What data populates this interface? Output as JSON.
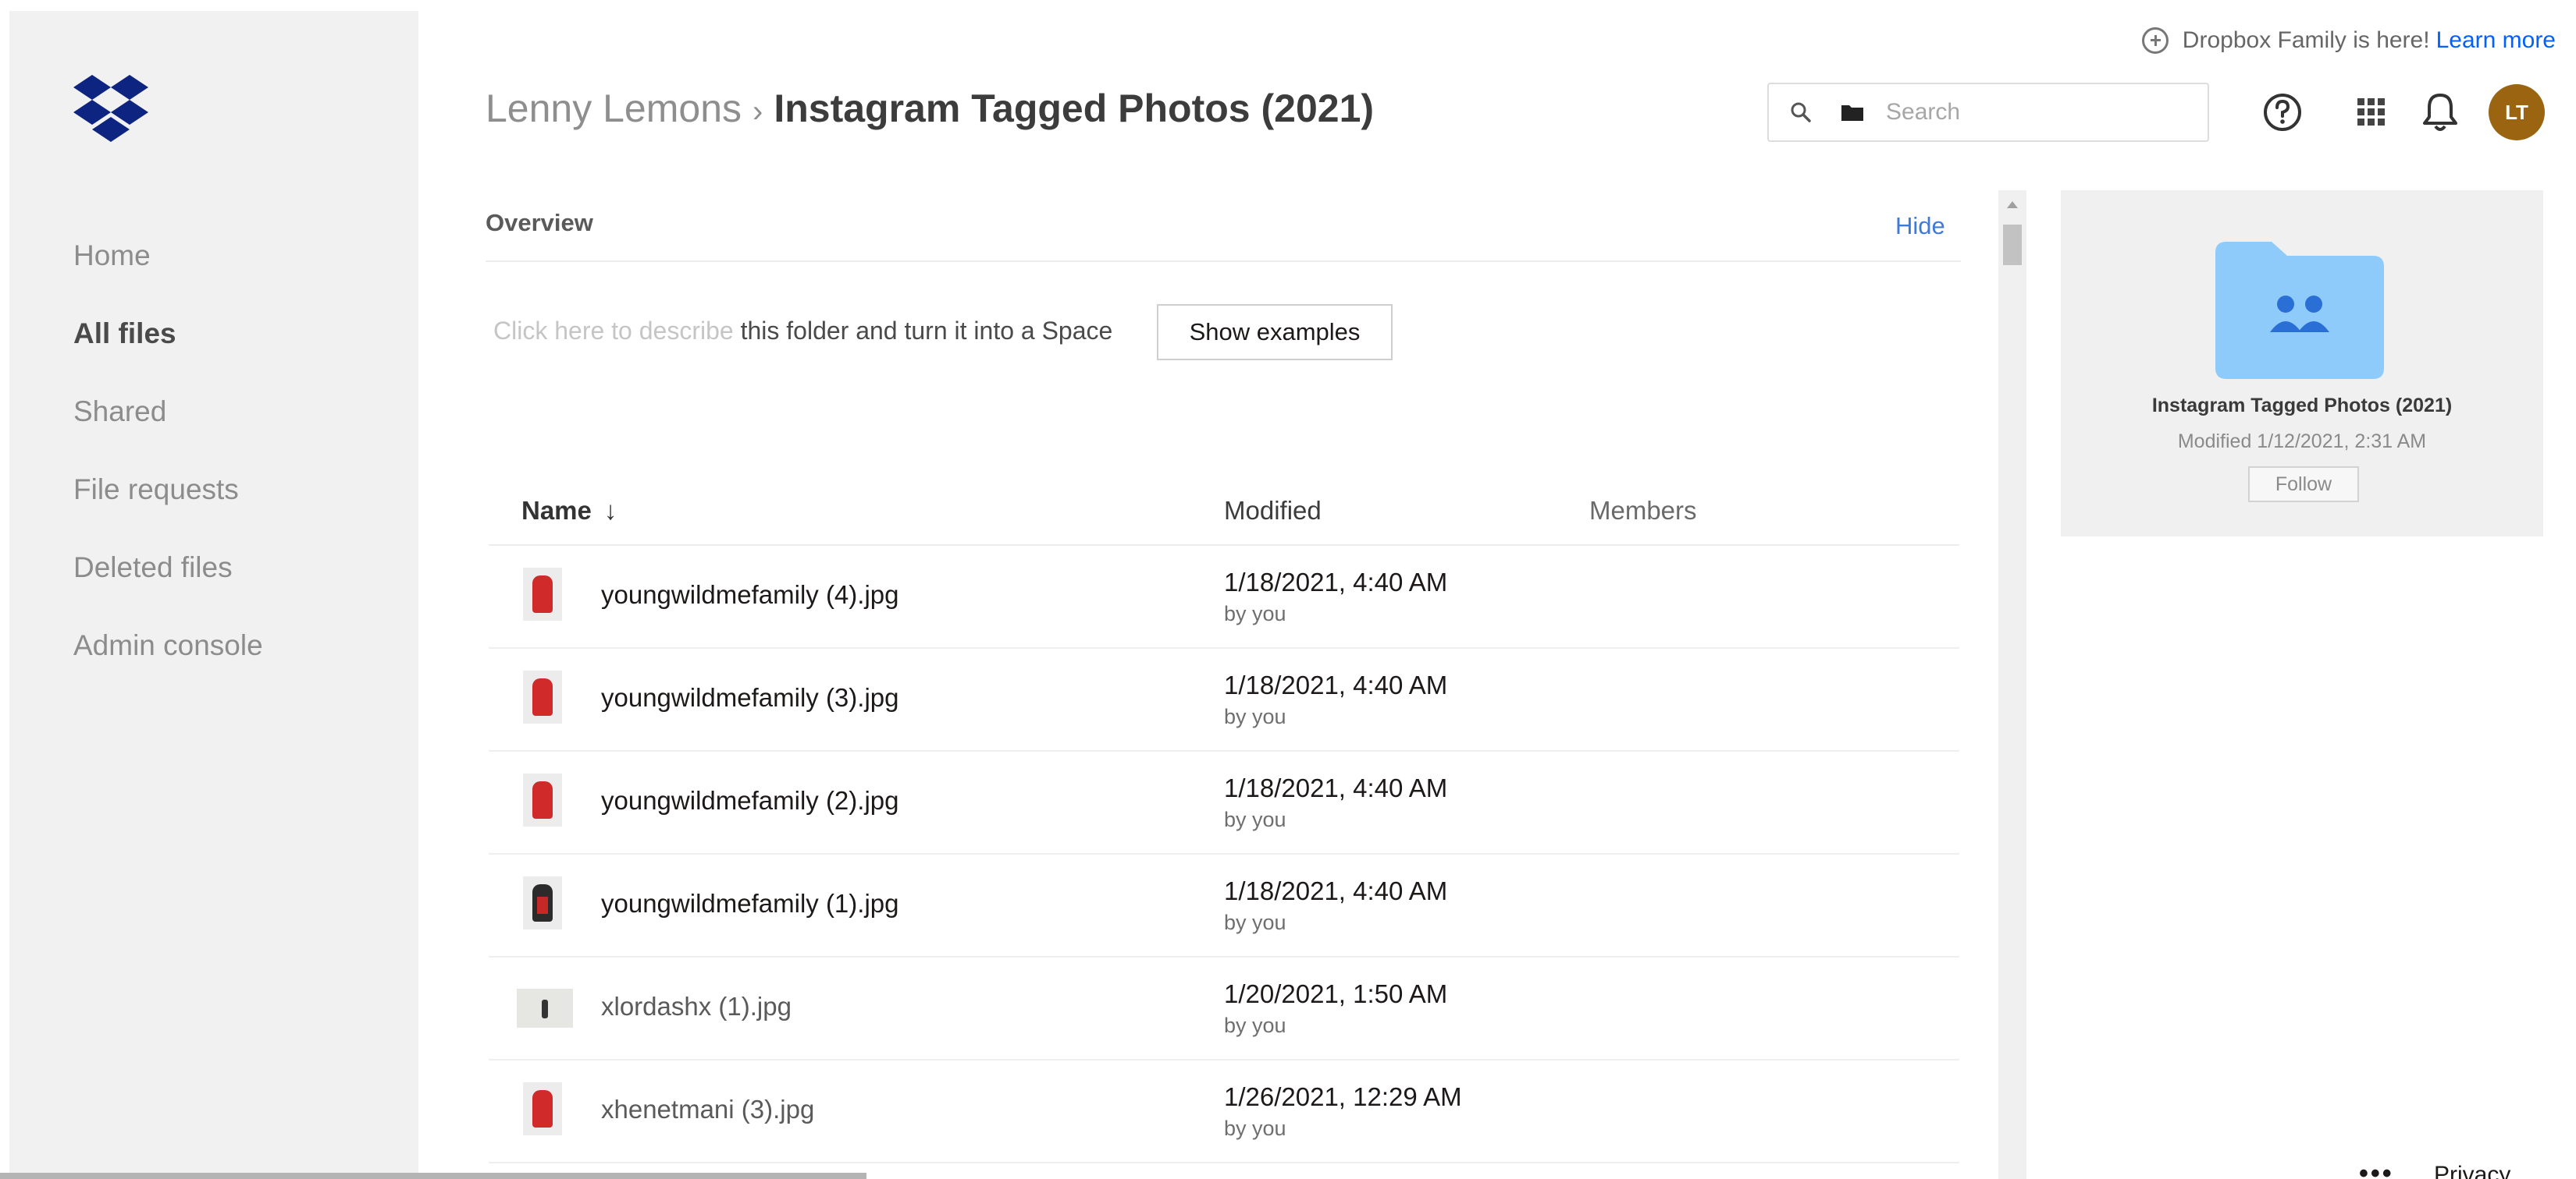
{
  "brand": {
    "logo_icon": "dropbox-logo-icon",
    "accent_color": "#0061fe",
    "folder_color": "#8ecbfb"
  },
  "sidebar": {
    "items": [
      {
        "label": "Home"
      },
      {
        "label": "All files",
        "active": true
      },
      {
        "label": "Shared"
      },
      {
        "label": "File requests"
      },
      {
        "label": "Deleted files"
      },
      {
        "label": "Admin console"
      }
    ]
  },
  "header": {
    "breadcrumb_parent": "Lenny Lemons",
    "breadcrumb_separator": "›",
    "breadcrumb_current": "Instagram Tagged Photos (2021)",
    "promo_text": "Dropbox Family is here!",
    "promo_link": "Learn more",
    "search_placeholder": "Search",
    "avatar_initials": "LT",
    "avatar_color": "#9a6410",
    "icons": [
      "help-icon",
      "apps-grid-icon",
      "notification-bell-icon"
    ]
  },
  "overview": {
    "title": "Overview",
    "hide_label": "Hide",
    "describe_faded": "Click here to describe",
    "describe_text": " this folder and turn it into a Space",
    "show_examples_label": "Show examples"
  },
  "table": {
    "columns": {
      "name": "Name",
      "sort_arrow": "↓",
      "modified": "Modified",
      "members": "Members"
    },
    "rows": [
      {
        "name": "youngwildmefamily (4).jpg",
        "modified": "1/18/2021, 4:40 AM",
        "by": "by you"
      },
      {
        "name": "youngwildmefamily (3).jpg",
        "modified": "1/18/2021, 4:40 AM",
        "by": "by you"
      },
      {
        "name": "youngwildmefamily (2).jpg",
        "modified": "1/18/2021, 4:40 AM",
        "by": "by you"
      },
      {
        "name": "youngwildmefamily (1).jpg",
        "modified": "1/18/2021, 4:40 AM",
        "by": "by you"
      },
      {
        "name": "xlordashx (1).jpg",
        "modified": "1/20/2021, 1:50 AM",
        "by": "by you"
      },
      {
        "name": "xhenetmani (3).jpg",
        "modified": "1/26/2021, 12:29 AM",
        "by": "by you"
      }
    ]
  },
  "info_panel": {
    "folder_name": "Instagram Tagged Photos (2021)",
    "modified": "Modified 1/12/2021, 2:31 AM",
    "follow_label": "Follow"
  },
  "footer": {
    "more_label": "•••",
    "privacy_label": "Privacy"
  }
}
